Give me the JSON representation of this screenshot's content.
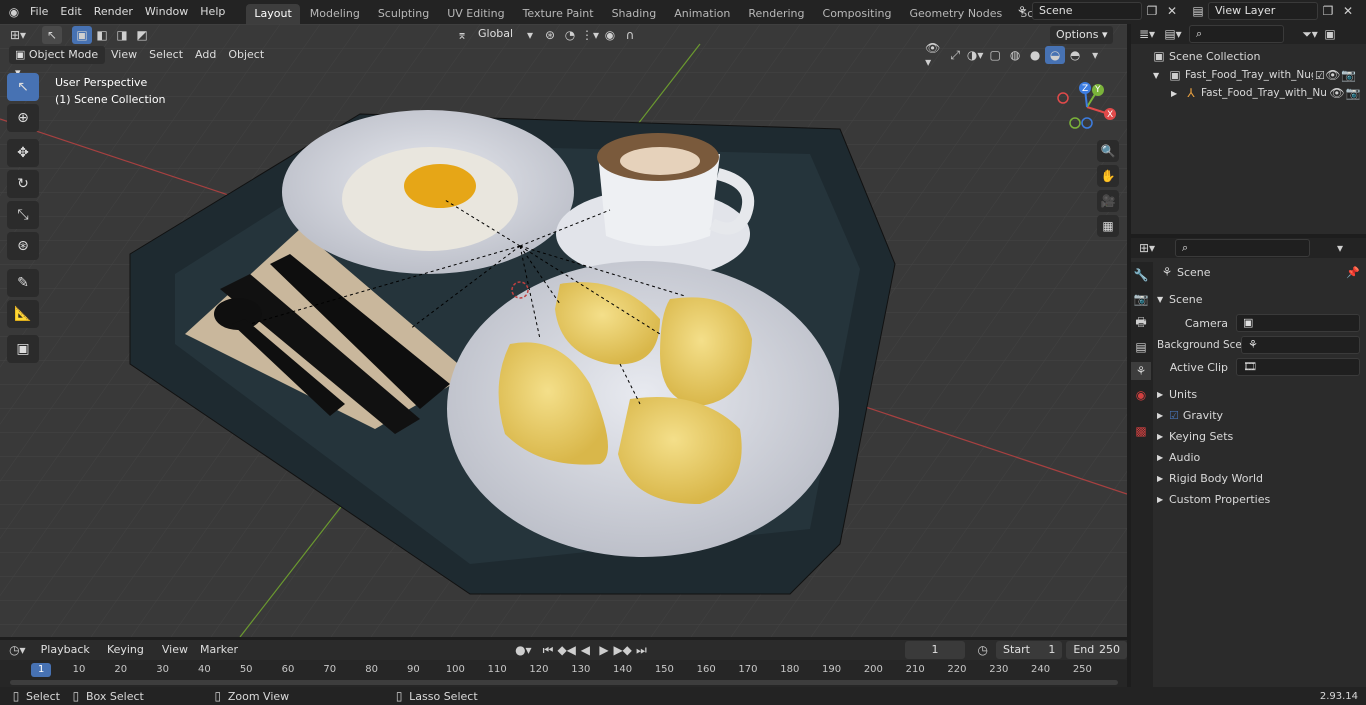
{
  "menu": [
    "File",
    "Edit",
    "Render",
    "Window",
    "Help"
  ],
  "workspaces": [
    "Layout",
    "Modeling",
    "Sculpting",
    "UV Editing",
    "Texture Paint",
    "Shading",
    "Animation",
    "Rendering",
    "Compositing",
    "Geometry Nodes",
    "Scripting"
  ],
  "active_workspace": "Layout",
  "add_workspace": "+",
  "scene_name": "Scene",
  "view_layer": "View Layer",
  "viewport": {
    "mode": "Object Mode",
    "menus": [
      "View",
      "Select",
      "Add",
      "Object"
    ],
    "orientation": "Global",
    "options": "Options",
    "perspective": "User Perspective",
    "collection_label": "(1) Scene Collection",
    "gizmo_x": "X",
    "gizmo_y": "Y",
    "gizmo_z": "Z"
  },
  "outliner": {
    "root": "Scene Collection",
    "items": [
      "Fast_Food_Tray_with_Nugget",
      "Fast_Food_Tray_with_Nu"
    ]
  },
  "properties": {
    "header": "Scene",
    "section": "Scene",
    "camera_label": "Camera",
    "bg_label": "Background Scene",
    "clip_label": "Active Clip",
    "panels": [
      "Units",
      "Gravity",
      "Keying Sets",
      "Audio",
      "Rigid Body World",
      "Custom Properties"
    ]
  },
  "timeline": {
    "menus": [
      "Playback",
      "Keying",
      "View",
      "Marker"
    ],
    "current_frame": "1",
    "start_label": "Start",
    "start": "1",
    "end_label": "End",
    "end": "250",
    "ticks": [
      "1",
      "10",
      "20",
      "30",
      "40",
      "50",
      "60",
      "70",
      "80",
      "90",
      "100",
      "110",
      "120",
      "130",
      "140",
      "150",
      "160",
      "170",
      "180",
      "190",
      "200",
      "210",
      "220",
      "230",
      "240",
      "250"
    ]
  },
  "status": {
    "select": "Select",
    "box_select": "Box Select",
    "zoom": "Zoom View",
    "lasso": "Lasso Select",
    "version": "2.93.14"
  },
  "colors": {
    "accent": "#4772b3",
    "x_axis": "#e04a4a",
    "y_axis": "#7bb33a",
    "z_axis": "#3d7de0"
  }
}
